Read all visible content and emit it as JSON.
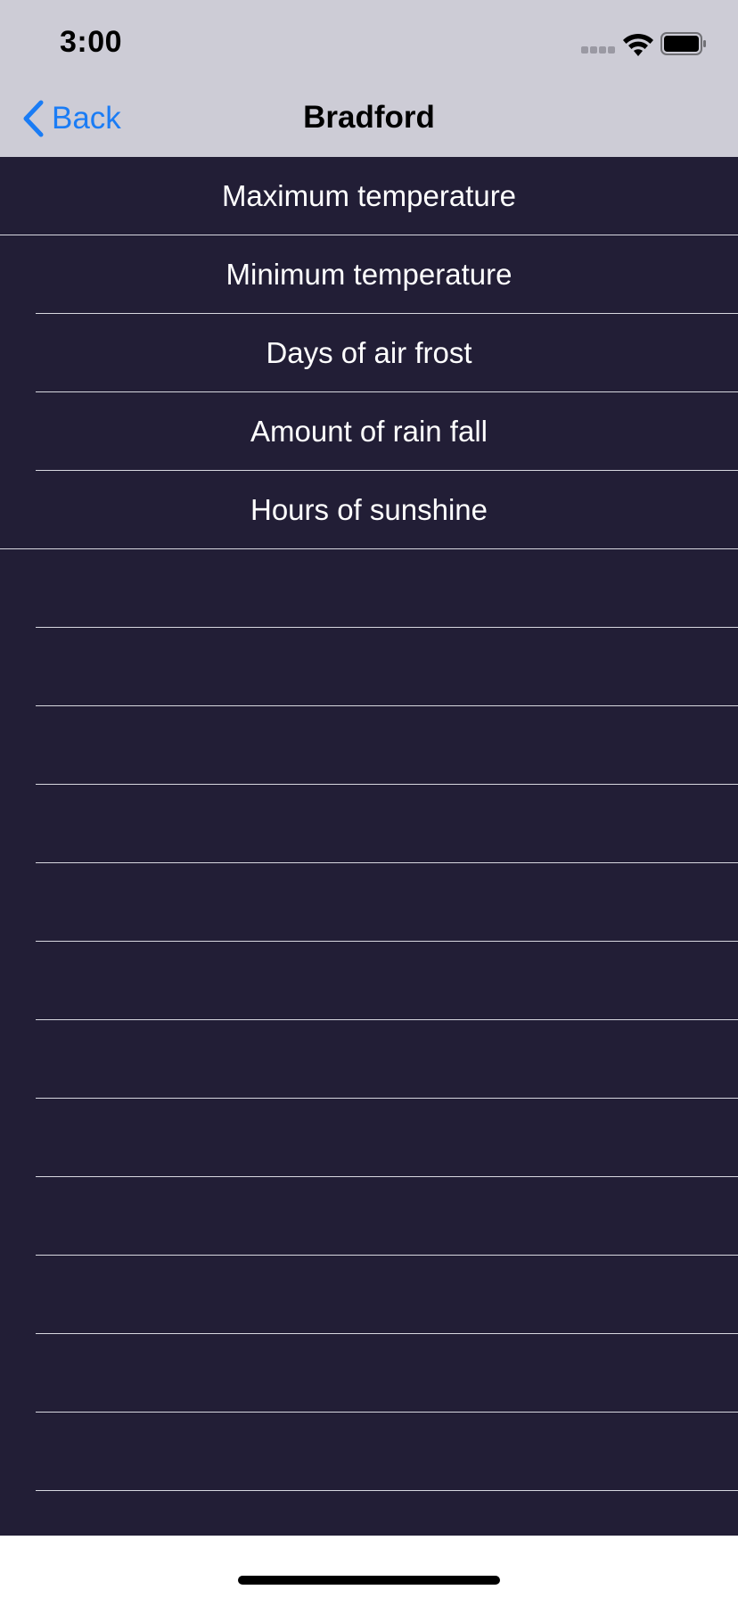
{
  "status_bar": {
    "time": "3:00"
  },
  "nav": {
    "back_label": "Back",
    "title": "Bradford",
    "accent_color": "#1a7cf5"
  },
  "list": {
    "items": [
      {
        "label": "Maximum temperature"
      },
      {
        "label": "Minimum temperature"
      },
      {
        "label": "Days of air frost"
      },
      {
        "label": "Amount of rain fall"
      },
      {
        "label": "Hours of sunshine"
      }
    ],
    "background_color": "#221e36"
  }
}
